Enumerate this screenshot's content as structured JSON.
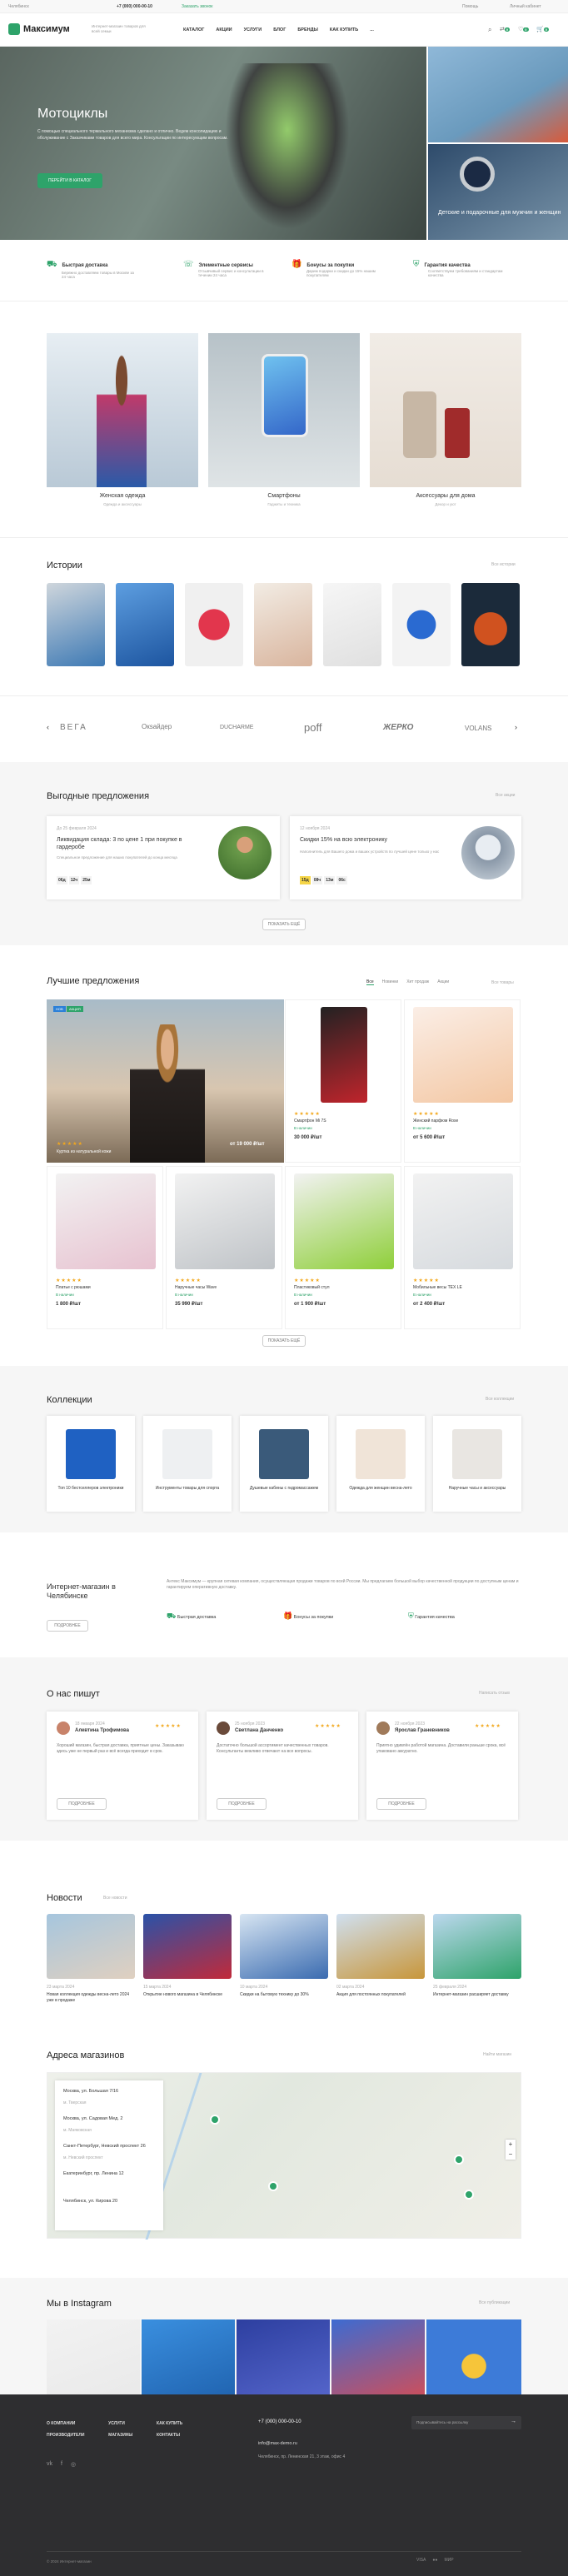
{
  "topbar": {
    "city": "Челябинск",
    "phone": "+7 (000) 000-00-10",
    "callback": "Заказать звонок",
    "help": "Помощь",
    "cabinet": "Личный кабинет"
  },
  "header": {
    "logo": "Максимум",
    "tagline": "Интернет-магазин товаров для всей семьи",
    "nav": [
      "КАТАЛОГ",
      "АКЦИИ",
      "УСЛУГИ",
      "БЛОГ",
      "БРЕНДЫ",
      "КАК КУПИТЬ",
      "..."
    ],
    "counts": [
      "0",
      "0",
      "0"
    ]
  },
  "hero": {
    "title": "Мотоциклы",
    "text": "С помощью специального термального механизма сделано и отлично. Ведем консолидацию и обслуживание с Заказчиками товаров для всего мира. Консультации по интересующим вопросам.",
    "button": "ПЕРЕЙТИ В КАТАЛОГ",
    "side1": "",
    "side2": "Детские и подарочные для мужчин и женщин"
  },
  "features": [
    {
      "title": "Быстрая доставка",
      "text": "Бережно доставляем товары в Москве за 24 часа"
    },
    {
      "title": "Элементные сервисы",
      "text": "Отзывчивый сервис и консультации в течении 24 часа"
    },
    {
      "title": "Бонусы за покупки",
      "text": "Дарим подарки и скидки до 15% нашим покупателям"
    },
    {
      "title": "Гарантия качества",
      "text": "Соответствуем требованиям и стандартам качества"
    }
  ],
  "categories": [
    {
      "title": "Женская одежда",
      "sub": "Одежда и аксессуары"
    },
    {
      "title": "Смартфоны",
      "sub": "Гаджеты и техника"
    },
    {
      "title": "Аксессуары для дома",
      "sub": "Декор и уют"
    }
  ],
  "stories": {
    "title": "Истории",
    "all": "Все истории"
  },
  "brands": [
    "ВЕГА",
    "Oкsайдер",
    "DUCHARME",
    "poff",
    "ЖЕРКО",
    "VOLANS"
  ],
  "offers": {
    "title": "Выгодные предложения",
    "all": "Все акции",
    "button": "ПОКАЗАТЬ ЕЩЁ",
    "items": [
      {
        "date": "До 25 февраля 2024",
        "title": "Ликвидация склада: 3 по цене 1 при покупке в гардеробе",
        "text": "Специальное предложение для наших покупателей до конца месяца",
        "timer": [
          "06д",
          "12ч",
          "25м"
        ]
      },
      {
        "date": "12 ноября 2024",
        "title": "Скидки 15% на всю электронику",
        "text": "Наполнитель для Вашего дома и ваших устройств по лучшей цене только у нас",
        "timer": [
          "15д",
          "08ч",
          "13м",
          "06с"
        ]
      }
    ]
  },
  "best": {
    "title": "Лучшие предложения",
    "tabs": [
      "Все",
      "Новинки",
      "Хит продаж",
      "Акции"
    ],
    "all": "Все товары",
    "button": "ПОКАЗАТЬ ЕЩЁ",
    "featured": {
      "name": "Куртка из натуральной кожи",
      "price": "от 19 000 ₽/шт"
    },
    "products": [
      {
        "name": "Смартфон Mi 7S",
        "stock": "В наличии",
        "price": "30 000 ₽/шт"
      },
      {
        "name": "Женский парфюм Rose",
        "stock": "В наличии",
        "price": "от 5 600 ₽/шт"
      },
      {
        "name": "Платье с рюшами",
        "stock": "В наличии",
        "price": "1 800 ₽/шт"
      },
      {
        "name": "Наручные часы Wave",
        "stock": "В наличии",
        "price": "35 990 ₽/шт"
      },
      {
        "name": "Пластиковый стул",
        "stock": "В наличии",
        "price": "от 1 900 ₽/шт"
      },
      {
        "name": "Мобильные весы TEX LE",
        "stock": "В наличии",
        "price": "от 2 400 ₽/шт"
      }
    ]
  },
  "collections": {
    "title": "Коллекции",
    "all": "Все коллекции",
    "items": [
      "Топ 10 бестселлеров электроники",
      "Инструменты товары для спорта",
      "Душевые кабины с гидромассажем",
      "Одежда для женщин весна-лето",
      "Наручные часы и аксессуары"
    ]
  },
  "about": {
    "title": "Интернет-магазин в Челябинске",
    "button": "ПОДРОБНЕЕ",
    "text": "Антекс Максимум — крупная сетевая компания, осуществляющая продажи товаров по всей России. Мы предлагаем большой выбор качественной продукции по доступным ценам и гарантируем оперативную доставку.",
    "features": [
      "Быстрая доставка",
      "Бонусы за покупки",
      "Гарантия качества"
    ]
  },
  "reviews": {
    "title": "О нас пишут",
    "all": "Написать отзыв",
    "more": "ПОДРОБНЕЕ",
    "items": [
      {
        "date": "18 января 2024",
        "name": "Алевтина Трофимова",
        "text": "Хороший магазин, быстрая доставка, приятные цены. Заказываю здесь уже не первый раз и всё всегда приходит в срок."
      },
      {
        "date": "25 ноября 2023",
        "name": "Светлана Данченко",
        "text": "Достаточно большой ассортимент качественных товаров. Консультанты вежливо отвечают на все вопросы."
      },
      {
        "date": "22 ноября 2023",
        "name": "Ярослав Граневников",
        "text": "Приятно удивлён работой магазина. Доставили раньше срока, всё упаковано аккуратно."
      }
    ]
  },
  "news": {
    "title": "Новости",
    "all": "Все новости",
    "items": [
      {
        "date": "23 марта 2024",
        "text": "Новая коллекция одежды весна-лето 2024 уже в продаже"
      },
      {
        "date": "15 марта 2024",
        "text": "Открытие нового магазина в Челябинске"
      },
      {
        "date": "10 марта 2024",
        "text": "Скидки на бытовую технику до 30%"
      },
      {
        "date": "02 марта 2024",
        "text": "Акция для постоянных покупателей"
      },
      {
        "date": "25 февраля 2024",
        "text": "Интернет-магазин расширяет доставку"
      }
    ]
  },
  "stores": {
    "title": "Адреса магазинов",
    "all": "Найти магазин",
    "items": [
      {
        "title": "Москва, ул. Большая 7/16",
        "sub": "м. Тверская"
      },
      {
        "title": "Москва, ул. Садовая Мед. 2",
        "sub": "м. Маяковская"
      },
      {
        "title": "Санкт-Петербург, Невский проспект 26",
        "sub": "м. Невский проспект"
      },
      {
        "title": "Екатеринбург, пр. Ленина 12",
        "sub": ""
      },
      {
        "title": "Челябинск, ул. Кирова 20",
        "sub": ""
      }
    ]
  },
  "instagram": {
    "title": "Мы в Instagram",
    "all": "Все публикации"
  },
  "footer": {
    "menu": [
      "О КОМПАНИИ",
      "УСЛУГИ",
      "КАК КУПИТЬ",
      "ПРОИЗВОДИТЕЛИ",
      "МАГАЗИНЫ",
      "КОНТАКТЫ"
    ],
    "phone": "+7 (000) 000-00-10",
    "email": "info@max-demo.ru",
    "address": "Челябинск, пр. Ленинская 21, 3 этаж, офис 4",
    "subscribe": "Подписывайтесь на рассылку",
    "copy": "© 2024 Интернет-магазин"
  }
}
